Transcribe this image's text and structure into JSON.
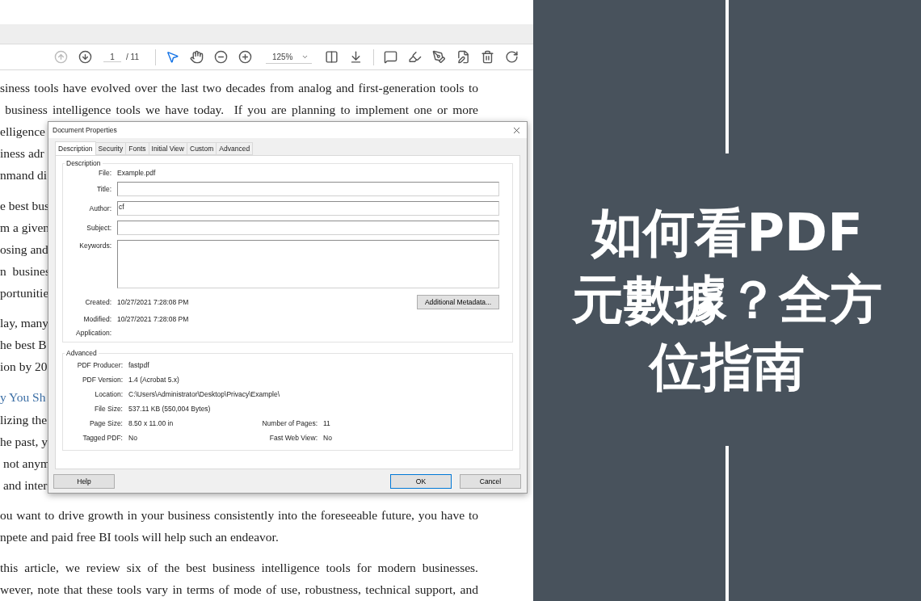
{
  "toolbar": {
    "previous_disabled": true,
    "page_value": "1",
    "page_total": "/ 11",
    "tools": [
      {
        "kind": "select",
        "selected": true
      },
      {
        "kind": "hand",
        "selected": false
      }
    ],
    "zoom": "125%"
  },
  "document": {
    "paragraphs": [
      {
        "kind": "text",
        "lines": [
          {
            "text": "siness tools have evolved over the last two decades from analog and first-generation tools to",
            "justified": true
          },
          {
            "text": " business intelligence tools we have today.  If you are planning to implement one or more",
            "justified": true
          },
          {
            "text": "elligence",
            "justified": false
          },
          {
            "text": "iness adr",
            "justified": false
          },
          {
            "text": "nmand di",
            "justified": false
          }
        ]
      },
      {
        "kind": "text",
        "lines": [
          {
            "text": "e best bus",
            "justified": false
          },
          {
            "text": "m a given",
            "justified": false
          },
          {
            "text": "osing and",
            "justified": false
          },
          {
            "text": "n  busines",
            "justified": false
          },
          {
            "text": "portunitie",
            "justified": false
          }
        ]
      },
      {
        "kind": "text",
        "lines": [
          {
            "text": "lay, many",
            "justified": false
          },
          {
            "text": "he best B",
            "justified": false
          },
          {
            "text": "ion by 20",
            "justified": false
          }
        ]
      },
      {
        "kind": "heading",
        "lines": [
          {
            "text": "y You Sh",
            "justified": false
          }
        ]
      },
      {
        "kind": "text",
        "lines": [
          {
            "text": "lizing the",
            "justified": false
          },
          {
            "text": "he past, y",
            "justified": false
          },
          {
            "text": " not anym",
            "justified": false
          },
          {
            "text": " and inter",
            "justified": false
          }
        ]
      },
      {
        "kind": "text",
        "lines": [
          {
            "text": "ou want to drive growth in your business consistently into the foreseeable future, you have to",
            "justified": true
          },
          {
            "text": "npete and paid free BI tools will help such an endeavor.",
            "justified": false
          }
        ]
      },
      {
        "kind": "text",
        "lines": [
          {
            "text": "this article, we review six of the best business intelligence tools for modern businesses.",
            "justified": true
          },
          {
            "text": "wever, note that these tools vary in terms of mode of use, robustness, technical support, and",
            "justified": true
          }
        ]
      }
    ]
  },
  "dialog": {
    "title": "Document Properties",
    "tabs": [
      {
        "label": "Description",
        "selected": true
      },
      {
        "label": "Security",
        "selected": false
      },
      {
        "label": "Fonts",
        "selected": false
      },
      {
        "label": "Initial View",
        "selected": false
      },
      {
        "label": "Custom",
        "selected": false
      },
      {
        "label": "Advanced",
        "selected": false
      }
    ],
    "description": {
      "heading": "Description",
      "fields": [
        {
          "kind": "static",
          "label": "File:",
          "value": "Example.pdf"
        },
        {
          "kind": "input",
          "label": "Title:"
        },
        {
          "kind": "input",
          "label": "Author:",
          "value": "cf"
        },
        {
          "kind": "input",
          "label": "Subject:"
        },
        {
          "kind": "textarea",
          "label": "Keywords:"
        }
      ],
      "dates": [
        {
          "label": "Created:",
          "value": "10/27/2021 7:28:08 PM"
        },
        {
          "label": "Modified:",
          "value": "10/27/2021 7:28:08 PM"
        },
        {
          "label": "Application:"
        }
      ],
      "metadata_button": "Additional Metadata..."
    },
    "advanced": {
      "heading": "Advanced",
      "rows": [
        [
          {
            "label": "PDF Producer:",
            "value": "fastpdf"
          }
        ],
        [
          {
            "label": "PDF Version:",
            "value": "1.4 (Acrobat 5.x)"
          }
        ],
        [
          {
            "label": "Location:",
            "value": "C:\\Users\\Administrator\\Desktop\\Privacy\\Example\\"
          }
        ],
        [
          {
            "label": "File Size:",
            "value": "537.11 KB (550,004 Bytes)"
          }
        ],
        [
          {
            "label": "Page Size:",
            "value": "8.50 x 11.00 in"
          },
          {
            "label": "Number of Pages:",
            "value": "11"
          }
        ],
        [
          {
            "label": "Tagged PDF:",
            "value": "No"
          },
          {
            "label": "Fast Web View:",
            "value": "No"
          }
        ]
      ]
    },
    "footer": {
      "left": [
        {
          "label": "Help",
          "default": false
        }
      ],
      "right": [
        {
          "label": "OK",
          "default": true
        },
        {
          "label": "Cancel",
          "default": false
        }
      ]
    }
  },
  "banner": {
    "title_lines": [
      "如何看PDF",
      "元數據？全方",
      "位指南"
    ]
  }
}
